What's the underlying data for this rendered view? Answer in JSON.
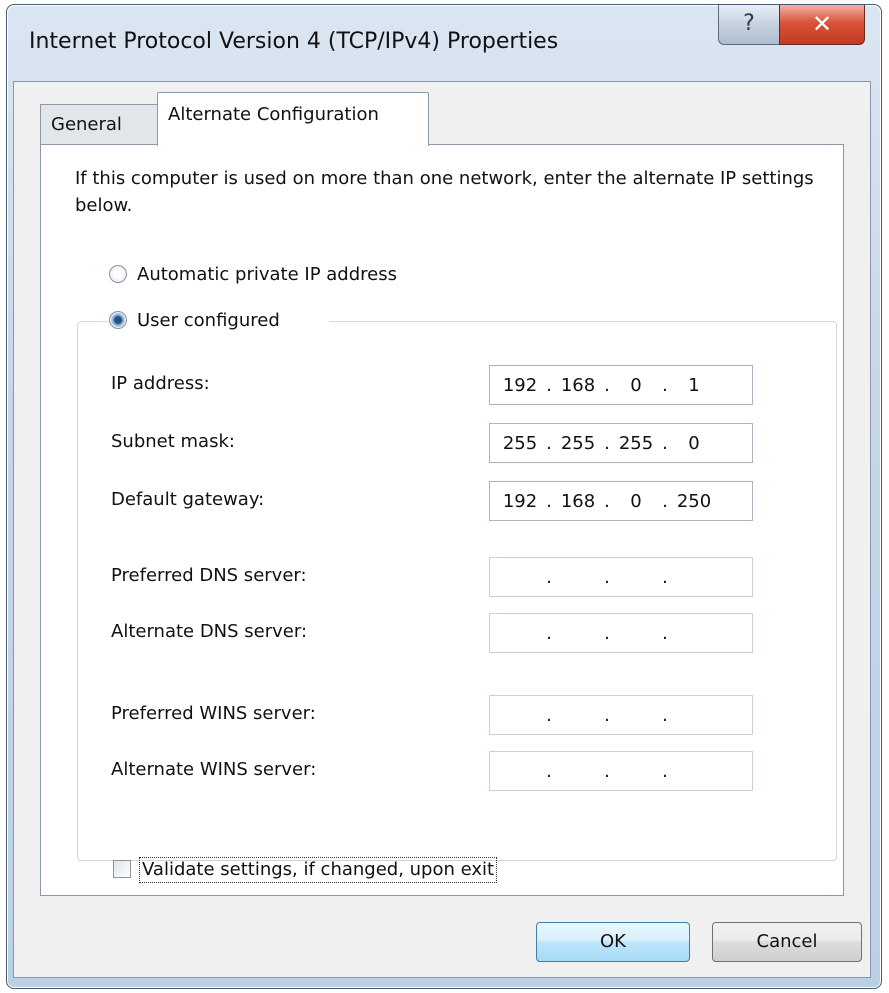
{
  "window": {
    "title": "Internet Protocol Version 4 (TCP/IPv4) Properties",
    "help_glyph": "?",
    "close_glyph": "✕"
  },
  "tabs": [
    {
      "label": "General",
      "selected": false
    },
    {
      "label": "Alternate Configuration",
      "selected": true
    }
  ],
  "panel": {
    "intro": "If this computer is used on more than one network, enter the alternate IP settings below.",
    "radio_auto": {
      "label": "Automatic private IP address",
      "checked": false
    },
    "radio_user": {
      "label": "User configured",
      "checked": true
    },
    "fields": [
      {
        "label": "IP address:",
        "octets": [
          "192",
          "168",
          "0",
          "1"
        ]
      },
      {
        "label": "Subnet mask:",
        "octets": [
          "255",
          "255",
          "255",
          "0"
        ]
      },
      {
        "label": "Default gateway:",
        "octets": [
          "192",
          "168",
          "0",
          "250"
        ]
      },
      {
        "label": "Preferred DNS server:",
        "octets": [
          "",
          "",
          "",
          ""
        ]
      },
      {
        "label": "Alternate DNS server:",
        "octets": [
          "",
          "",
          "",
          ""
        ]
      },
      {
        "label": "Preferred WINS server:",
        "octets": [
          "",
          "",
          "",
          ""
        ]
      },
      {
        "label": "Alternate WINS server:",
        "octets": [
          "",
          "",
          "",
          ""
        ]
      }
    ],
    "validate": {
      "label": "Validate settings, if changed, upon exit",
      "checked": false
    }
  },
  "buttons": {
    "ok": "OK",
    "cancel": "Cancel"
  },
  "colors": {
    "ok_border": "#3c7fb1",
    "close_red": "#c23a22"
  }
}
